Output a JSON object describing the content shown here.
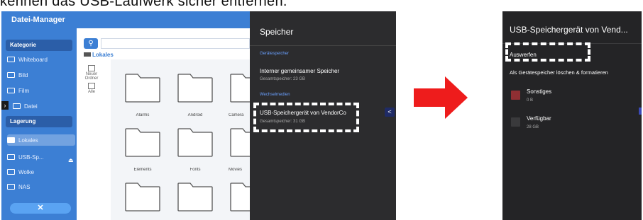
{
  "header_text": "kennen das USB-Laufwerk sicher entfernen.",
  "file_manager": {
    "title": "Datei-Manager",
    "category_label": "Kategorie",
    "categories": [
      {
        "label": "Whiteboard"
      },
      {
        "label": "Bild"
      },
      {
        "label": "Film"
      },
      {
        "label": "Datei"
      }
    ],
    "storage_label": "Lagerung",
    "storages": [
      {
        "label": "Lokales"
      },
      {
        "label": "USB-Sp..."
      },
      {
        "label": "Wolke"
      },
      {
        "label": "NAS"
      }
    ],
    "close_glyph": "✕",
    "breadcrumb": "Lokales",
    "tools": [
      {
        "label": "Neuer Ordner"
      },
      {
        "label": "Alle"
      }
    ],
    "folders": [
      {
        "label": "Alarms"
      },
      {
        "label": "Android"
      },
      {
        "label": "Camera"
      },
      {
        "label": "Elements"
      },
      {
        "label": "Fonts"
      },
      {
        "label": "Movies"
      },
      {
        "label": ""
      },
      {
        "label": ""
      },
      {
        "label": ""
      }
    ]
  },
  "storage_panel": {
    "title": "Speicher",
    "device_section": "Gerätespeicher",
    "internal_title": "Interner gemeinsamer Speicher",
    "internal_sub": "Gesamtspeicher: 23 GB",
    "removable_section": "Wechselmedien",
    "usb_title": "USB-Speichergerät von VendorCo",
    "usb_sub": "Gesamtspeicher: 31 GB",
    "tab_glyph": "<"
  },
  "usb_panel": {
    "title": "USB-Speichergerät von Vend...",
    "eject_label": "Auswerfen",
    "format_label": "Als Gerätespeicher löschen & formatieren",
    "items": [
      {
        "label": "Sonstiges",
        "value": "0 B",
        "color": "#8f2f33"
      },
      {
        "label": "Verfügbar",
        "value": "28 GB",
        "color": "#3a3a3c"
      }
    ]
  },
  "colors": {
    "sidebar_blue": "#3c7fd4",
    "arrow_red": "#ee1c1c",
    "panel_dark": "#2c2c2e"
  }
}
